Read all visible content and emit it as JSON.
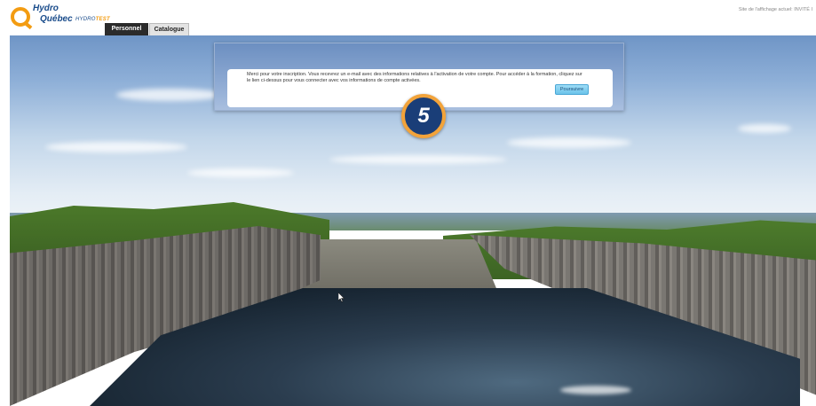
{
  "header": {
    "logo": {
      "brand_line1": "Hydro",
      "brand_line2": "Québec",
      "suffix_prefix": "HYDRO",
      "suffix_accent": "TEST"
    },
    "tabs": [
      {
        "label": "Personnel",
        "active": true
      },
      {
        "label": "Catalogue",
        "active": false
      }
    ],
    "site_info": "Site de l'affichage actuel: INVITÉ I"
  },
  "dialog": {
    "message": "Merci pour votre inscription. Vous recevrez un e-mail avec des informations relatives à l'activation de votre compte. Pour accéder à la formation, cliquez sur le lien ci-dessus pour vous connecter avec vos informations de compte activées.",
    "continue_label": "Poursuivre"
  },
  "step_badge": {
    "number": "5"
  },
  "colors": {
    "brand_blue": "#1a4c8b",
    "brand_orange": "#f39c12",
    "tab_active_bg": "#2b2b2b",
    "badge_bg": "#1a3e78",
    "badge_ring": "#f2a33a",
    "button_bg": "#6cc3ea"
  },
  "icons": {
    "cursor": "mouse-pointer-icon",
    "logo": "hydro-quebec-logo-icon"
  }
}
